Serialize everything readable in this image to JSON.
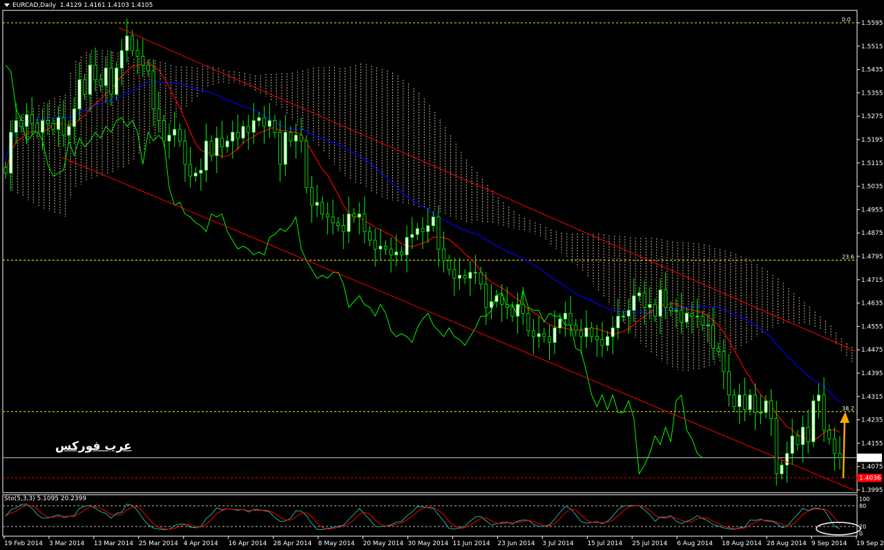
{
  "header": {
    "symbol": "EURCAD,Daily",
    "ohlc": "1.4129 1.4161 1.4103 1.4105"
  },
  "watermark": "عرب فوركس",
  "colors": {
    "background": "#000000",
    "bull_candle": "#ffffff",
    "bear_candle": "#000000",
    "candle_outline": "#00ff00",
    "tenkan": "#ff0000",
    "kijun": "#0000ff",
    "chikou": "#00ff00",
    "kumo": "#f5deb3",
    "channel": "#ff0000",
    "fib": "#ffff00",
    "current_price_line": "#b0c4de",
    "support_line": "#ff0000",
    "arrow": "#ffa500",
    "sto_main": "#20b2aa",
    "sto_signal": "#ff0000"
  },
  "chart_data": {
    "type": "candlestick",
    "x_ticks": [
      "19 Feb 2014",
      "3 Mar 2014",
      "13 Mar 2014",
      "25 Mar 2014",
      "4 Apr 2014",
      "16 Apr 2014",
      "28 Apr 2014",
      "8 May 2014",
      "20 May 2014",
      "30 May 2014",
      "11 Jun 2014",
      "23 Jun 2014",
      "3 Jul 2014",
      "15 Jul 2014",
      "25 Jul 2014",
      "6 Aug 2014",
      "18 Aug 2014",
      "28 Aug 2014",
      "9 Sep 2014",
      "19 Sep 2014"
    ],
    "y_ticks": [
      "1.5595",
      "1.5515",
      "1.5435",
      "1.5355",
      "1.5275",
      "1.5195",
      "1.5115",
      "1.5035",
      "1.4955",
      "1.4875",
      "1.4795",
      "1.4715",
      "1.4635",
      "1.4555",
      "1.4475",
      "1.4395",
      "1.4315",
      "1.4235",
      "1.4155",
      "1.4075",
      "1.3995"
    ],
    "ylim": [
      1.3995,
      1.5595
    ],
    "fib_levels": [
      {
        "label": "0.0",
        "price": 1.5595
      },
      {
        "label": "23.6",
        "price": 1.4782
      },
      {
        "label": "38.2",
        "price": 1.4263
      }
    ],
    "current_price": "1.4105",
    "support_price": "1.4036",
    "close_series": [
      1.508,
      1.522,
      1.526,
      1.524,
      1.528,
      1.525,
      1.522,
      1.526,
      1.525,
      1.523,
      1.527,
      1.521,
      1.524,
      1.53,
      1.54,
      1.535,
      1.545,
      1.54,
      1.538,
      1.544,
      1.535,
      1.544,
      1.55,
      1.555,
      1.55,
      1.548,
      1.545,
      1.543,
      1.53,
      1.526,
      1.519,
      1.521,
      1.523,
      1.519,
      1.511,
      1.507,
      1.508,
      1.509,
      1.519,
      1.514,
      1.52,
      1.517,
      1.519,
      1.522,
      1.52,
      1.524,
      1.522,
      1.526,
      1.527,
      1.524,
      1.526,
      1.522,
      1.511,
      1.522,
      1.519,
      1.521,
      1.519,
      1.503,
      1.497,
      1.498,
      1.494,
      1.493,
      1.491,
      1.49,
      1.488,
      1.494,
      1.493,
      1.494,
      1.488,
      1.485,
      1.482,
      1.483,
      1.482,
      1.48,
      1.481,
      1.48,
      1.486,
      1.487,
      1.489,
      1.488,
      1.49,
      1.493,
      1.482,
      1.478,
      1.475,
      1.472,
      1.473,
      1.472,
      1.474,
      1.474,
      1.47,
      1.462,
      1.464,
      1.466,
      1.463,
      1.462,
      1.459,
      1.463,
      1.46,
      1.454,
      1.452,
      1.453,
      1.452,
      1.45,
      1.455,
      1.458,
      1.46,
      1.456,
      1.454,
      1.452,
      1.455,
      1.452,
      1.451,
      1.449,
      1.452,
      1.455,
      1.459,
      1.459,
      1.461,
      1.466,
      1.467,
      1.462,
      1.463,
      1.459,
      1.468,
      1.462,
      1.461,
      1.461,
      1.457,
      1.46,
      1.459,
      1.459,
      1.456,
      1.456,
      1.448,
      1.447,
      1.44,
      1.432,
      1.428,
      1.432,
      1.427,
      1.432,
      1.426,
      1.426,
      1.43,
      1.424,
      1.405,
      1.408,
      1.412,
      1.418,
      1.415,
      1.421,
      1.416,
      1.43,
      1.432,
      1.42,
      1.417,
      1.412,
      1.4105
    ],
    "series": [
      {
        "name": "Sto(5,3,3)",
        "value": "5.1095"
      },
      {
        "name": "Signal",
        "value": "20.2399"
      }
    ],
    "sto_levels": [
      "100",
      "80",
      "20",
      "0"
    ]
  },
  "sto": {
    "label": "Sto(5,3,3) 5.1095 20.2399"
  }
}
